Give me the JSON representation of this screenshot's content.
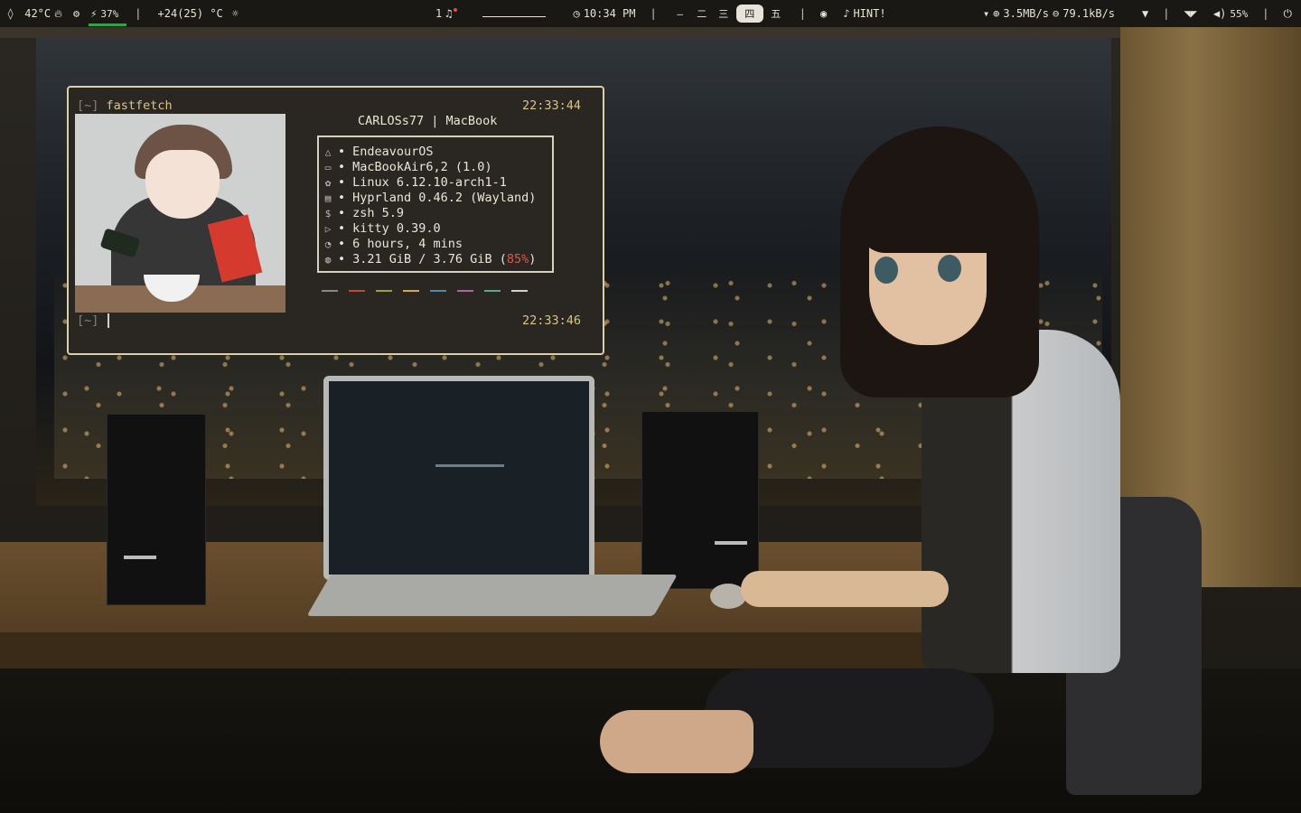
{
  "topbar": {
    "left": {
      "temp_cpu": "42°C",
      "battery_pct": "37%",
      "weather": "+24(25) °C"
    },
    "center": {
      "notification_count": "1",
      "clock": "10:34 PM",
      "workspaces": [
        "—",
        "二",
        "三",
        "四",
        "五"
      ],
      "active_workspace": "四",
      "hint": "HINT!"
    },
    "right": {
      "upload": "3.5MB/s",
      "download": "79.1kB/s",
      "volume": "55%"
    }
  },
  "terminal": {
    "prompt1": "[~]",
    "command": "fastfetch",
    "time1": "22:33:44",
    "header": "CARLOSs77 | MacBook",
    "info": [
      {
        "icon": "arch-icon",
        "text": "EndeavourOS"
      },
      {
        "icon": "laptop-icon",
        "text": "MacBookAir6,2 (1.0)"
      },
      {
        "icon": "gear-icon",
        "text": "Linux 6.12.10-arch1-1"
      },
      {
        "icon": "window-icon",
        "text": "Hyprland 0.46.2 (Wayland)"
      },
      {
        "icon": "dollar-icon",
        "text": "zsh 5.9"
      },
      {
        "icon": "terminal-icon",
        "text": "kitty 0.39.0"
      },
      {
        "icon": "clock-icon",
        "text": "6 hours, 4 mins"
      }
    ],
    "memory": {
      "icon": "chip-icon",
      "used": "3.21 GiB / 3.76 GiB (",
      "percent": "85%",
      "close": ")"
    },
    "palette": [
      "#8e887c",
      "#c8453c",
      "#9aa33a",
      "#d4a93a",
      "#4f8aa8",
      "#b065a0",
      "#5aa895",
      "#d8d0c0"
    ],
    "prompt2": "[~]",
    "time2": "22:33:46"
  }
}
